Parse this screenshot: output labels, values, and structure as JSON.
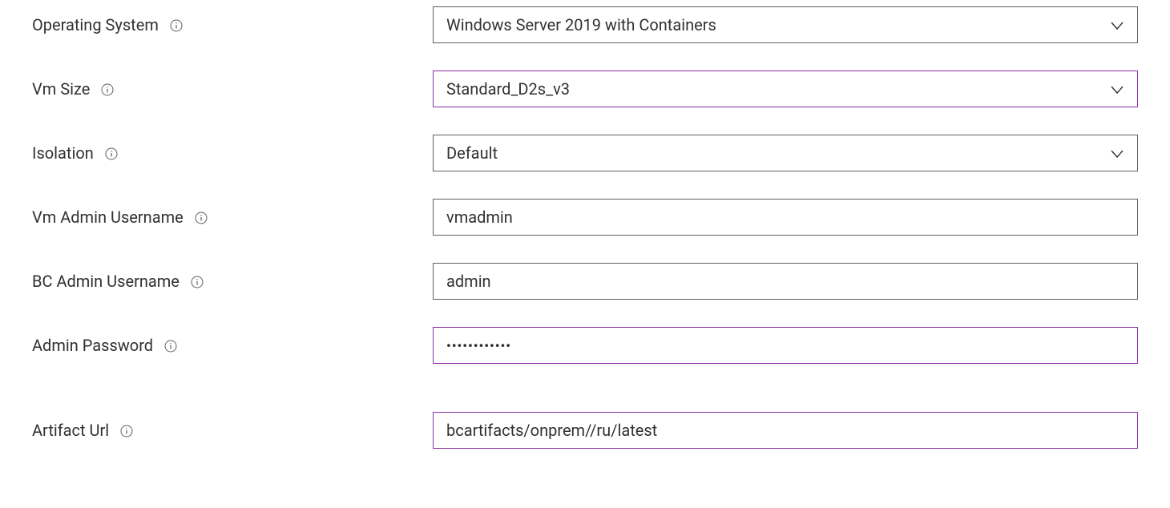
{
  "fields": {
    "operatingSystem": {
      "label": "Operating System",
      "value": "Windows Server 2019 with Containers",
      "type": "dropdown",
      "accent": false
    },
    "vmSize": {
      "label": "Vm Size",
      "value": "Standard_D2s_v3",
      "type": "dropdown",
      "accent": true
    },
    "isolation": {
      "label": "Isolation",
      "value": "Default",
      "type": "dropdown",
      "accent": false
    },
    "vmAdminUsername": {
      "label": "Vm Admin Username",
      "value": "vmadmin",
      "type": "text",
      "accent": false
    },
    "bcAdminUsername": {
      "label": "BC Admin Username",
      "value": "admin",
      "type": "text",
      "accent": false
    },
    "adminPassword": {
      "label": "Admin Password",
      "value": "••••••••••••",
      "type": "password",
      "accent": true
    },
    "artifactUrl": {
      "label": "Artifact Url",
      "value": "bcartifacts/onprem//ru/latest",
      "type": "text",
      "accent": true
    }
  }
}
